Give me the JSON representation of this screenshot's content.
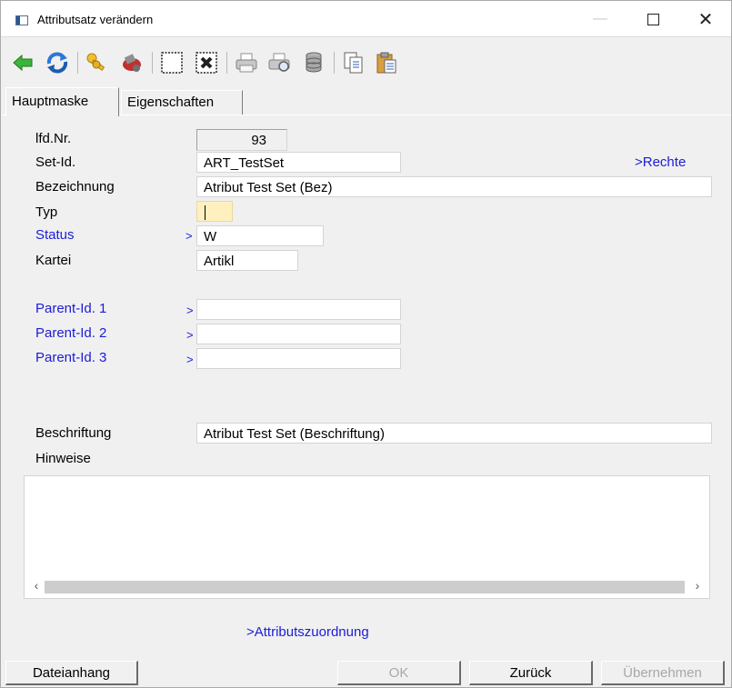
{
  "window": {
    "title": "Attributsatz verändern",
    "minimize_glyph": "—",
    "close_glyph": "✕"
  },
  "toolbar": {
    "icons": [
      "back-arrow-icon",
      "refresh-icon",
      "keys-icon",
      "edit-icon",
      "select-box-icon",
      "delete-box-icon",
      "print-icon",
      "print-preview-icon",
      "database-icon",
      "copy-document-icon",
      "paste-icon"
    ]
  },
  "tabs": [
    {
      "label": "Hauptmaske",
      "active": true
    },
    {
      "label": "Eigenschaften",
      "active": false
    }
  ],
  "form": {
    "lfd_nr": {
      "label": "lfd.Nr.",
      "value": "93"
    },
    "set_id": {
      "label": "Set-Id.",
      "value": "ART_TestSet"
    },
    "rechte_link": ">Rechte",
    "bezeichnung": {
      "label": "Bezeichnung",
      "value": "Atribut Test Set (Bez)"
    },
    "typ": {
      "label": "Typ",
      "value": ""
    },
    "status": {
      "label": "Status",
      "arrow": ">",
      "value": "W"
    },
    "kartei": {
      "label": "Kartei",
      "value": "Artikl"
    },
    "parent1": {
      "label": "Parent-Id. 1",
      "arrow": ">",
      "value": ""
    },
    "parent2": {
      "label": "Parent-Id. 2",
      "arrow": ">",
      "value": ""
    },
    "parent3": {
      "label": "Parent-Id. 3",
      "arrow": ">",
      "value": ""
    },
    "beschriftung": {
      "label": "Beschriftung",
      "value": "Atribut Test Set (Beschriftung)"
    },
    "hinweise": {
      "label": "Hinweise",
      "value": ""
    },
    "attributszuordnung_link": ">Attributszuordnung"
  },
  "scrollbar": {
    "left": "‹",
    "right": "›"
  },
  "buttons": {
    "dateianhang": "Dateianhang",
    "ok": "OK",
    "zurueck": "Zurück",
    "uebernehmen": "Übernehmen"
  },
  "colors": {
    "link": "#1c1cd6",
    "typ_field": "#fff0c0",
    "background": "#f0f0f0"
  }
}
